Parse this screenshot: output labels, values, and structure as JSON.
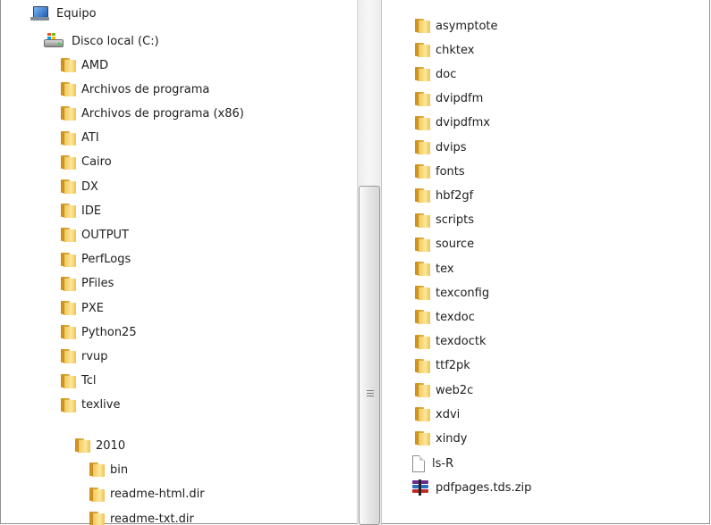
{
  "tree": {
    "computer": "Equipo",
    "drive": "Disco local (C:)",
    "folders": [
      "AMD",
      "Archivos de programa",
      "Archivos de programa (x86)",
      "ATI",
      "Cairo",
      "DX",
      "IDE",
      "OUTPUT",
      "PerfLogs",
      "PFiles",
      "PXE",
      "Python25",
      "rvup",
      "Tcl",
      "texlive"
    ],
    "sub_folder": "2010",
    "sub_items": [
      "bin",
      "readme-html.dir",
      "readme-txt.dir"
    ]
  },
  "content": {
    "folders": [
      "asymptote",
      "chktex",
      "doc",
      "dvipdfm",
      "dvipdfmx",
      "dvips",
      "fonts",
      "hbf2gf",
      "scripts",
      "source",
      "tex",
      "texconfig",
      "texdoc",
      "texdoctk",
      "ttf2pk",
      "web2c",
      "xdvi",
      "xindy"
    ],
    "files": [
      {
        "name": "ls-R",
        "icon": "document-icon"
      },
      {
        "name": "pdfpages.tds.zip",
        "icon": "winrar-archive-icon"
      }
    ]
  },
  "colors": {
    "folder": "#f2c85c",
    "selection": "#cce8ff"
  }
}
